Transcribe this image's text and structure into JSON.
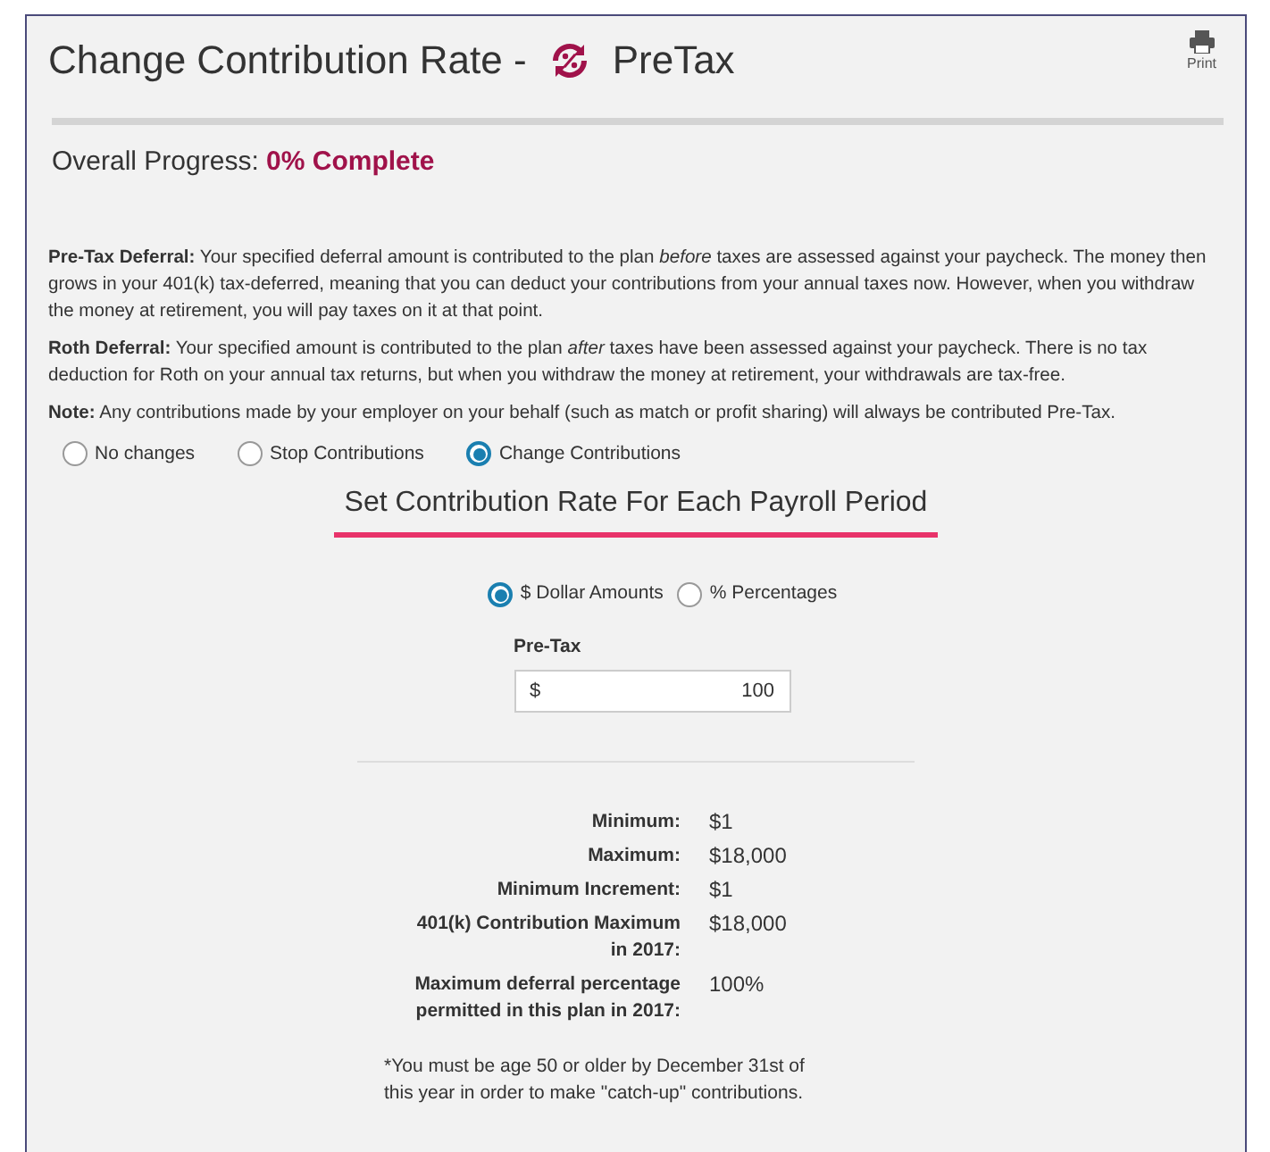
{
  "header": {
    "title": "Change Contribution Rate -",
    "type": "PreTax",
    "print_label": "Print"
  },
  "progress": {
    "label": "Overall Progress:",
    "value": "0% Complete"
  },
  "paragraphs": [
    "**Pre-Tax Deferral:** Your specified deferral amount is contributed to the plan *before* taxes are assessed against your paycheck. The money then grows in your 401(k) tax-deferred, meaning that you can deduct your contributions from your annual taxes now. However, when you withdraw the money at retirement, you will pay taxes on it at that point.",
    "**Roth Deferral:** Your specified amount is contributed to the plan *after* taxes have been assessed against your paycheck. There is no tax deduction for Roth on your annual tax returns, but when you withdraw the money at retirement, your withdrawals are tax-free.",
    "**Note:** Any contributions made by your employer on your behalf (such as match or profit sharing) will always be contributed Pre-Tax."
  ],
  "options": [
    {
      "label": "No changes",
      "selected": false
    },
    {
      "label": "Stop Contributions",
      "selected": false
    },
    {
      "label": "Change Contributions",
      "selected": true
    }
  ],
  "section_title": "Set Contribution Rate For Each Payroll Period",
  "units": [
    {
      "label": "$ Dollar Amounts",
      "selected": true
    },
    {
      "label": "% Percentages",
      "selected": false
    }
  ],
  "field": {
    "label": "Pre-Tax",
    "prefix": "$",
    "value": "100"
  },
  "limits": [
    {
      "label": "Minimum:",
      "value": "$1"
    },
    {
      "label": "Maximum:",
      "value": "$18,000"
    },
    {
      "label": "Minimum Increment:",
      "value": "$1"
    },
    {
      "label": "401(k) Contribution Maximum in 2017:",
      "value": "$18,000"
    },
    {
      "label": "Maximum deferral percentage permitted in this plan in 2017:",
      "value": "100%"
    }
  ],
  "footnote": "*You must be age 50 or older by December 31st of this year in order to make \"catch-up\" contributions."
}
